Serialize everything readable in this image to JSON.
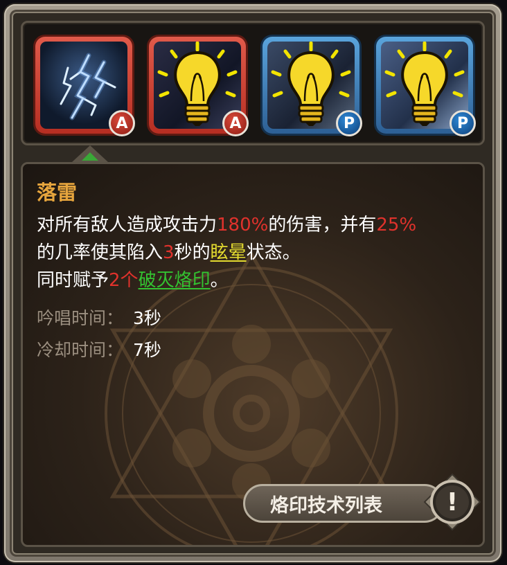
{
  "skills": [
    {
      "name": "落雷",
      "badge": "A",
      "selected": true,
      "style": "red",
      "icon": "lightning-icon"
    },
    {
      "badge": "A",
      "style": "red",
      "icon": "lightbulb-icon"
    },
    {
      "badge": "P",
      "style": "blue",
      "icon": "lightbulb-icon"
    },
    {
      "badge": "P",
      "style": "blue",
      "icon": "lightbulb-icon"
    }
  ],
  "detail": {
    "title": "落雷",
    "line1": {
      "a": "对所有敌人造成攻击力",
      "b": "180%",
      "c": "的伤害，并有",
      "d": "25%"
    },
    "line2": {
      "a": "的几率使其陷入",
      "b": "3",
      "c": "秒的",
      "d": "眩晕",
      "e": "状态。"
    },
    "line3": {
      "a": "同时赋予",
      "b": "2个",
      "c": "破灭烙印",
      "d": "。"
    },
    "cast_label": "吟唱时间：",
    "cast_value": "3秒",
    "cooldown_label": "冷却时间：",
    "cooldown_value": "7秒"
  },
  "buttons": {
    "list_label": "烙印技术列表",
    "alert_glyph": "!"
  },
  "colors": {
    "title": "#e6a53d",
    "highlight_red": "#e0322c",
    "highlight_yellow": "#e4db2f",
    "highlight_green": "#33c331"
  }
}
